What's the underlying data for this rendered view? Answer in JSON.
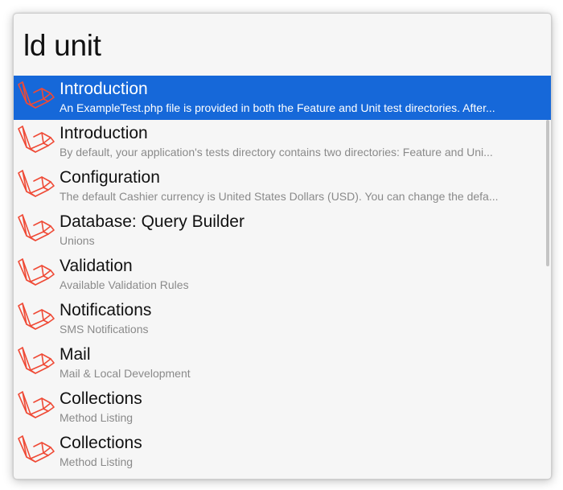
{
  "search": {
    "query": "ld unit"
  },
  "colors": {
    "selection": "#1668d9",
    "icon": "#ef4a36"
  },
  "icon": "laravel-logo-icon",
  "results": [
    {
      "title": "Introduction",
      "subtitle": "An ExampleTest.php file is provided in both the Feature and Unit test directories. After...",
      "selected": true
    },
    {
      "title": "Introduction",
      "subtitle": "By default, your application's tests directory contains two directories: Feature and Uni...",
      "selected": false
    },
    {
      "title": "Configuration",
      "subtitle": "The default Cashier currency is United States Dollars (USD). You can change the defa...",
      "selected": false
    },
    {
      "title": "Database: Query Builder",
      "subtitle": "Unions",
      "selected": false
    },
    {
      "title": "Validation",
      "subtitle": "Available Validation Rules",
      "selected": false
    },
    {
      "title": "Notifications",
      "subtitle": "SMS Notifications",
      "selected": false
    },
    {
      "title": "Mail",
      "subtitle": "Mail & Local Development",
      "selected": false
    },
    {
      "title": "Collections",
      "subtitle": "Method Listing",
      "selected": false
    },
    {
      "title": "Collections",
      "subtitle": "Method Listing",
      "selected": false
    }
  ]
}
